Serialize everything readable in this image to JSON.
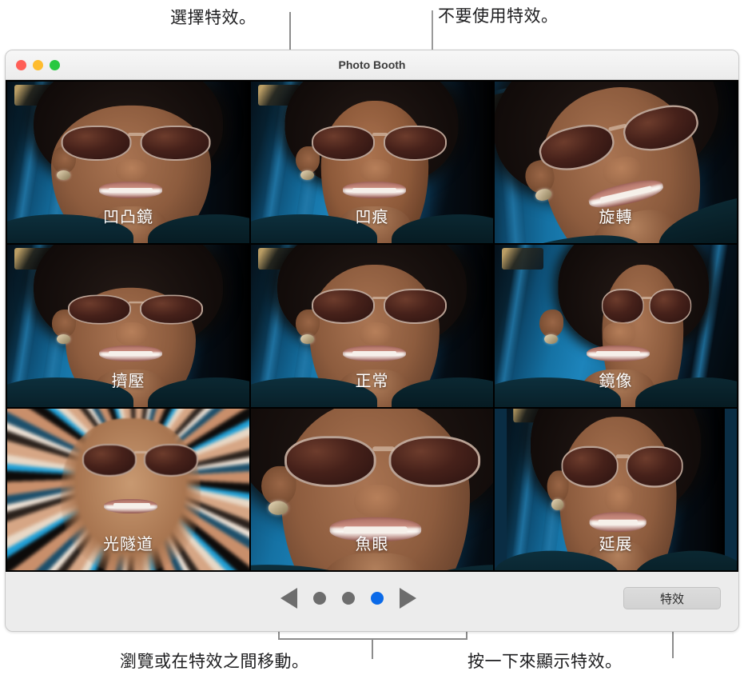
{
  "annotations": {
    "top_left": "選擇特效。",
    "top_right": "不要使用特效。",
    "bottom_left": "瀏覽或在特效之間移動。",
    "bottom_right": "按一下來顯示特效。"
  },
  "window": {
    "title": "Photo Booth",
    "traffic_lights": {
      "close": "close-button",
      "minimize": "minimize-button",
      "zoom": "zoom-button"
    }
  },
  "effects_grid": {
    "rows": 3,
    "columns": 3,
    "tiles": [
      {
        "label": "凹凸鏡",
        "fx": "fx-bump",
        "selected": false
      },
      {
        "label": "凹痕",
        "fx": "fx-dent",
        "selected": false
      },
      {
        "label": "旋轉",
        "fx": "fx-twirl",
        "selected": false
      },
      {
        "label": "擠壓",
        "fx": "fx-squeeze",
        "selected": false
      },
      {
        "label": "正常",
        "fx": "fx-normal",
        "selected": true
      },
      {
        "label": "鏡像",
        "fx": "fx-mirror",
        "selected": false
      },
      {
        "label": "光隧道",
        "fx": "fx-tunnel",
        "selected": false
      },
      {
        "label": "魚眼",
        "fx": "fx-fisheye",
        "selected": false
      },
      {
        "label": "延展",
        "fx": "fx-stretch",
        "selected": false
      }
    ]
  },
  "toolbar": {
    "prev_icon": "triangle-left-icon",
    "next_icon": "triangle-right-icon",
    "page_dots": [
      {
        "active": false
      },
      {
        "active": false
      },
      {
        "active": true
      }
    ],
    "effects_button_label": "特效"
  },
  "colors": {
    "accent_blue": "#0b6ae8",
    "dot_gray": "#6d6d6d",
    "window_chrome": "#ececec",
    "traffic_close": "#ff5f57",
    "traffic_minimize": "#febc2e",
    "traffic_zoom": "#28c840",
    "leader_line": "#8c8c8c",
    "label_text": "#ffffff"
  }
}
